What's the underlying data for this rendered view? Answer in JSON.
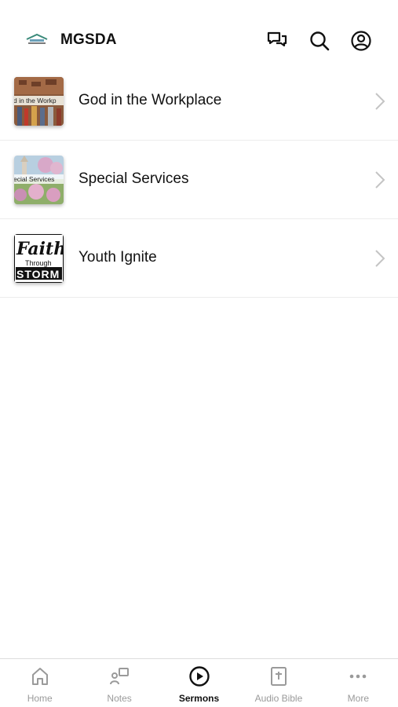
{
  "header": {
    "title": "MGSDA",
    "logo_icon": "church-logo",
    "actions": [
      "chat-icon",
      "search-icon",
      "account-icon"
    ]
  },
  "series": [
    {
      "title": "God in the Workplace",
      "thumb_text": "d in the Workp"
    },
    {
      "title": "Special Services",
      "thumb_text": "ecial Services"
    },
    {
      "title": "Youth Ignite",
      "thumb_text_1": "Faith",
      "thumb_text_2": "Through",
      "thumb_text_3": "STORM"
    }
  ],
  "tabs": [
    {
      "label": "Home",
      "icon": "home-icon"
    },
    {
      "label": "Notes",
      "icon": "notes-icon"
    },
    {
      "label": "Sermons",
      "icon": "play-icon",
      "active": true
    },
    {
      "label": "Audio Bible",
      "icon": "bible-icon"
    },
    {
      "label": "More",
      "icon": "more-icon"
    }
  ],
  "colors": {
    "active": "#111111",
    "inactive": "#9a9a9a",
    "divider": "#ececec"
  }
}
